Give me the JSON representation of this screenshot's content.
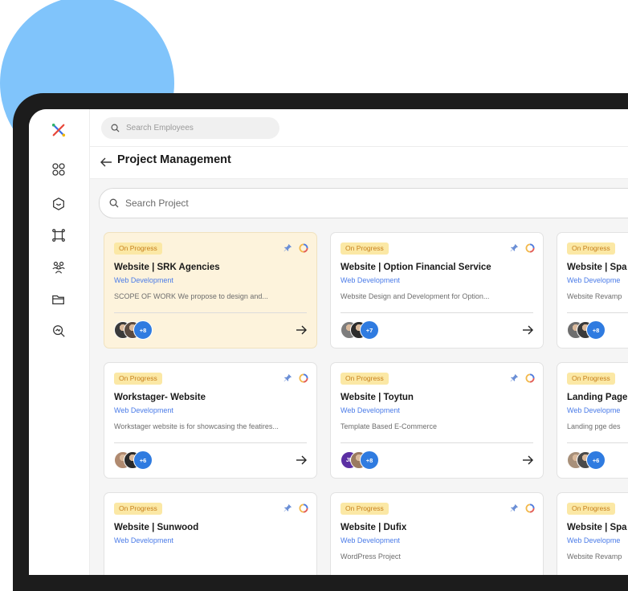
{
  "topbar": {
    "employee_search_placeholder": "Search Employees"
  },
  "page": {
    "title": "Project Management"
  },
  "project_search": {
    "placeholder": "Search Project"
  },
  "colors": {
    "accent_blue": "#4a7be8",
    "badge_bg": "#fbe8a5",
    "badge_text": "#c7801d",
    "highlight_card": "#fdf3dc",
    "avatar_count_bg": "#2f7be0"
  },
  "sidebar": {
    "items": [
      "logo-icon",
      "dashboard-icon",
      "clients-icon",
      "projects-icon",
      "team-icon",
      "folder-icon",
      "search-insights-icon"
    ]
  },
  "cards": [
    {
      "status": "On Progress",
      "title": "Website | SRK Agencies",
      "category": "Web Development",
      "description": "SCOPE OF WORK We propose to design and...",
      "extra_members": "+8",
      "avatars": [
        "#3a3a3a",
        "#5a4a40"
      ]
    },
    {
      "status": "On Progress",
      "title": "Website | Option Financial Service",
      "category": "Web Development",
      "description": "Website Design and Development for Option...",
      "extra_members": "+7",
      "avatars": [
        "#7d7d7d",
        "#2c2c2c"
      ]
    },
    {
      "status": "On Progress",
      "title": "Website | Spa",
      "category": "Web Developme",
      "description": "Website Revamp",
      "extra_members": "+8",
      "avatars": [
        "#6e6e6e",
        "#3a3a3a"
      ]
    },
    {
      "status": "On Progress",
      "title": "Workstager- Website",
      "category": "Web Development",
      "description": "Workstager website is for showcasing the featires...",
      "extra_members": "+6",
      "avatars": [
        "#b08a70",
        "#2a2a2a"
      ]
    },
    {
      "status": "On Progress",
      "title": "Website | Toytun",
      "category": "Web Development",
      "description": "Template Based E-Commerce",
      "extra_members": "+8",
      "initials": "JF",
      "avatars": [
        "#5b2fa3",
        "#9a7a60"
      ]
    },
    {
      "status": "On Progress",
      "title": "Landing Page",
      "category": "Web Developme",
      "description": "Landing pge des",
      "extra_members": "+6",
      "avatars": [
        "#a8907a",
        "#4a4a4a"
      ]
    },
    {
      "status": "On Progress",
      "title": "Website | Sunwood",
      "category": "Web Development",
      "description": ""
    },
    {
      "status": "On Progress",
      "title": "Website | Dufix",
      "category": "Web Development",
      "description": "WordPress Project"
    },
    {
      "status": "On Progress",
      "title": "Website | Spa",
      "category": "Web Developme",
      "description": "Website Revamp"
    }
  ]
}
